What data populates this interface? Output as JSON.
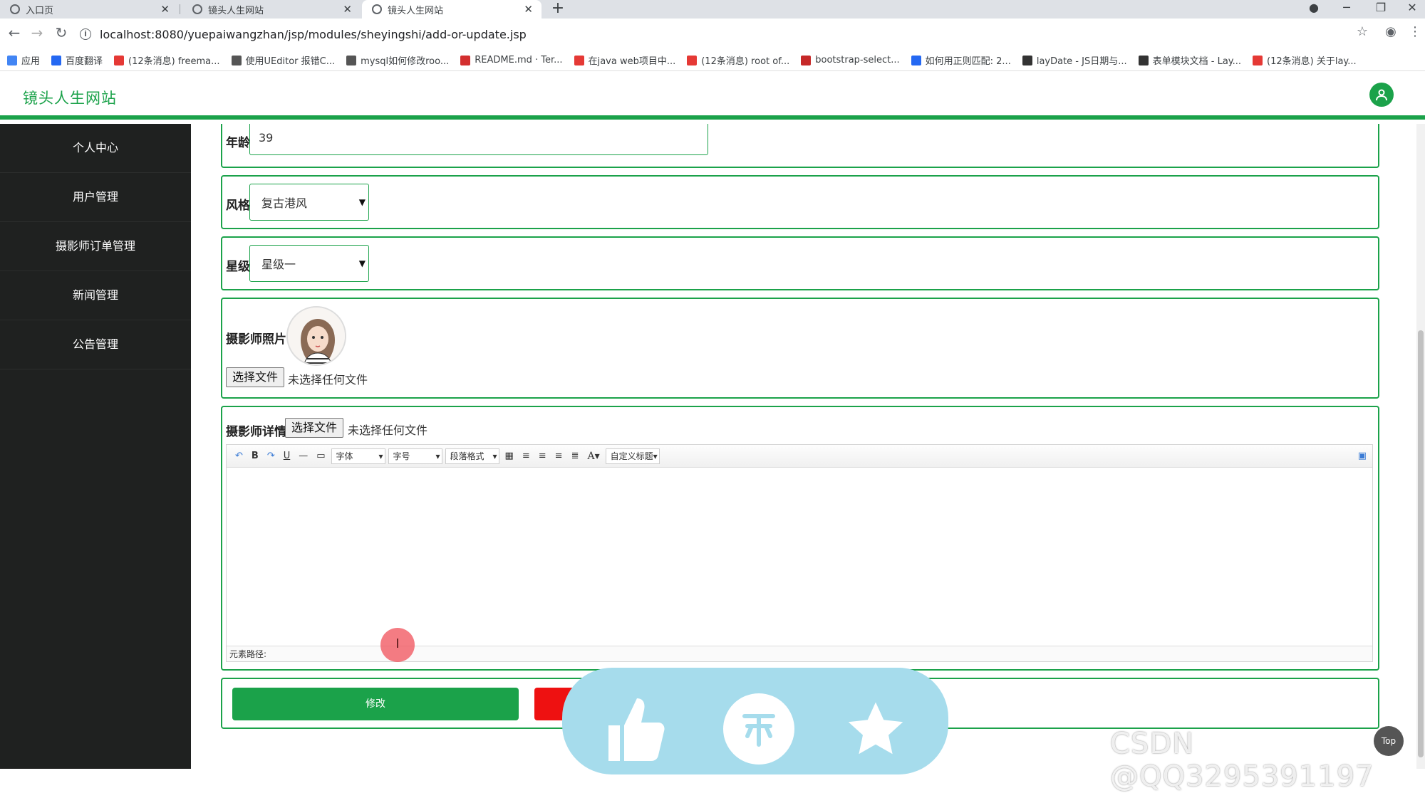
{
  "browser": {
    "tabs": [
      {
        "title": "入口页"
      },
      {
        "title": "镜头人生网站"
      },
      {
        "title": "镜头人生网站"
      }
    ],
    "url": "localhost:8080/yuepaiwangzhan/jsp/modules/sheyingshi/add-or-update.jsp",
    "bookmarks": [
      {
        "label": "应用",
        "color": "#4285f4"
      },
      {
        "label": "百度翻译",
        "color": "#2468f2"
      },
      {
        "label": "(12条消息) freema...",
        "color": "#e53935"
      },
      {
        "label": "使用UEditor 报错C...",
        "color": "#555555"
      },
      {
        "label": "mysql如何修改roo...",
        "color": "#555555"
      },
      {
        "label": "README.md · Ter...",
        "color": "#d32f2f"
      },
      {
        "label": "在java web项目中...",
        "color": "#e53935"
      },
      {
        "label": "(12条消息) root of...",
        "color": "#e53935"
      },
      {
        "label": "bootstrap-select...",
        "color": "#c62828"
      },
      {
        "label": "如何用正则匹配: 2...",
        "color": "#2468f2"
      },
      {
        "label": "layDate - JS日期与...",
        "color": "#333333"
      },
      {
        "label": "表单模块文档 - Lay...",
        "color": "#333333"
      },
      {
        "label": "(12条消息) 关于lay...",
        "color": "#e53935"
      }
    ]
  },
  "site": {
    "title": "镜头人生网站",
    "brand_color": "#1ba24a"
  },
  "sidebar": {
    "items": [
      {
        "label": "个人中心"
      },
      {
        "label": "用户管理"
      },
      {
        "label": "摄影师订单管理"
      },
      {
        "label": "新闻管理"
      },
      {
        "label": "公告管理"
      }
    ]
  },
  "form": {
    "age": {
      "label": "年龄",
      "value": "39"
    },
    "style": {
      "label": "风格",
      "value": "复古港风"
    },
    "rating": {
      "label": "星级",
      "value": "星级一"
    },
    "photo": {
      "label": "摄影师照片",
      "file_button": "选择文件",
      "file_status": "未选择任何文件"
    },
    "detail": {
      "label": "摄影师详情",
      "file_button": "选择文件",
      "file_status": "未选择任何文件",
      "toolbar": {
        "font": "字体",
        "size": "字号",
        "paragraph": "段落格式",
        "custom_title": "自定义标题"
      },
      "element_path": "元素路径:"
    },
    "submit_label": "修改"
  },
  "overlay": {
    "watermark": "CSDN @QQ3295391197",
    "top_label": "Top"
  }
}
